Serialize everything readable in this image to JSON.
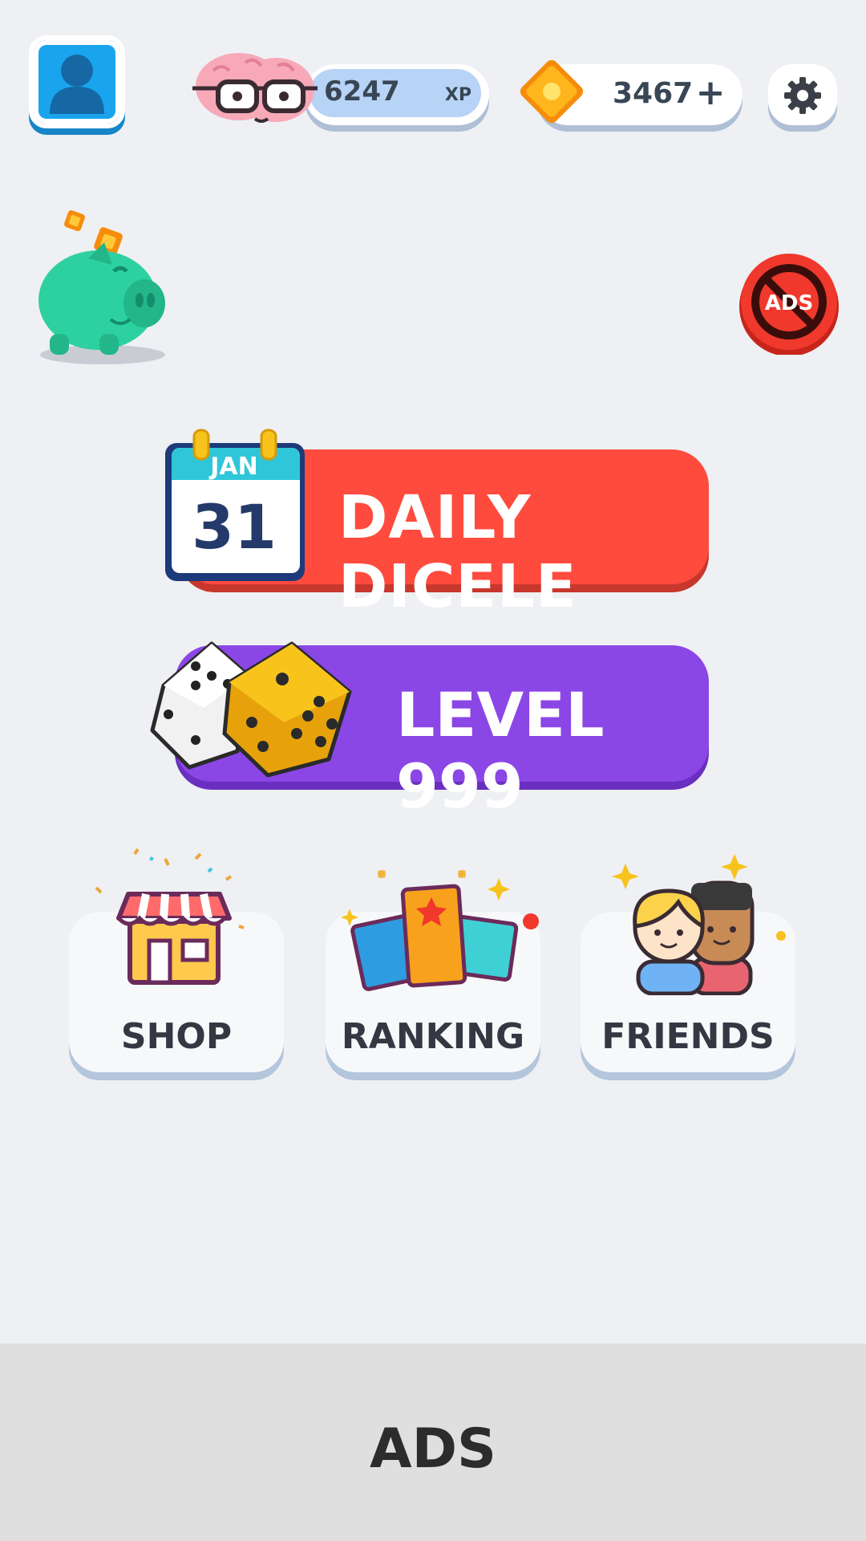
{
  "header": {
    "xp": {
      "value": "6247",
      "unit": "XP"
    },
    "coins": {
      "value": "3467",
      "add_label": "+"
    }
  },
  "daily": {
    "month": "JAN",
    "day": "31",
    "label": "DAILY DICELE"
  },
  "level": {
    "label": "LEVEL 999"
  },
  "cards": [
    {
      "label": "SHOP",
      "icon": "shop-icon"
    },
    {
      "label": "RANKING",
      "icon": "ranking-icon"
    },
    {
      "label": "FRIENDS",
      "icon": "friends-icon"
    }
  ],
  "no_ads_badge": {
    "label": "ADS"
  },
  "ad_banner": {
    "label": "ADS"
  },
  "colors": {
    "background": "#eef0f3",
    "daily": "#ff4b3e",
    "level": "#8b46e6",
    "profile": "#1aa4ee",
    "xp_fill": "#b7d3f6"
  }
}
